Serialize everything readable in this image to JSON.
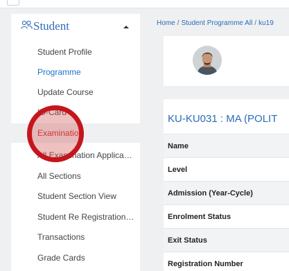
{
  "sidebar": {
    "title": "Student",
    "items": [
      {
        "label": "Student Profile",
        "style": "normal"
      },
      {
        "label": "Programme",
        "style": "link"
      },
      {
        "label": "Update Course",
        "style": "normal"
      },
      {
        "label": "ID-Card",
        "style": "normal"
      },
      {
        "label": "Examination",
        "style": "active"
      },
      {
        "label": "All Examination Applications",
        "style": "normal"
      },
      {
        "label": "All Sections",
        "style": "normal"
      },
      {
        "label": "Student Section View",
        "style": "normal"
      },
      {
        "label": "Student Re Registration Vi...",
        "style": "normal"
      },
      {
        "label": "Transactions",
        "style": "normal"
      },
      {
        "label": "Grade Cards",
        "style": "normal"
      }
    ]
  },
  "breadcrumb": {
    "home": "Home",
    "separator": "/",
    "page": "Student Programme All",
    "current": "ku19"
  },
  "programme_card": {
    "title": "KU-KU031 : MA (POLIT",
    "rows": [
      {
        "label": "Name"
      },
      {
        "label": "Level"
      },
      {
        "label": "Admission (Year-Cycle)"
      },
      {
        "label": "Enrolment Status"
      },
      {
        "label": "Exit Status"
      },
      {
        "label": "Registration Number"
      }
    ]
  },
  "colors": {
    "accent": "#2b6cb8",
    "active": "#d21c1c",
    "highlight": "#c4161c"
  }
}
